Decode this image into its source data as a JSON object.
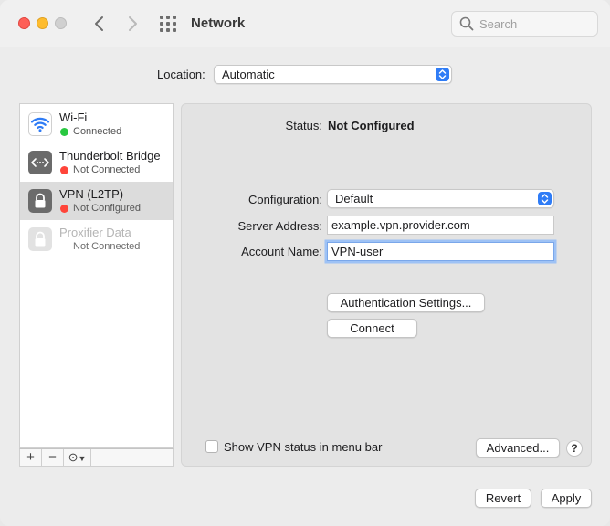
{
  "window": {
    "title": "Network"
  },
  "search": {
    "placeholder": "Search"
  },
  "location": {
    "label": "Location:",
    "value": "Automatic"
  },
  "services": [
    {
      "name": "Wi-Fi",
      "status": "Connected",
      "status_color": "#28c840",
      "icon": "wifi-icon"
    },
    {
      "name": "Thunderbolt Bridge",
      "status": "Not Connected",
      "status_color": "#ff453a",
      "icon": "thunderbolt-bridge-icon"
    },
    {
      "name": "VPN (L2TP)",
      "status": "Not Configured",
      "status_color": "#ff453a",
      "icon": "lock-icon",
      "selected": true
    },
    {
      "name": "Proxifier Data",
      "status": "Not Connected",
      "icon": "lock-icon",
      "disabled": true
    }
  ],
  "sidebar_controls": {
    "add": "+",
    "remove": "−",
    "action": "⊙"
  },
  "detail": {
    "status_label": "Status:",
    "status_value": "Not Configured",
    "configuration_label": "Configuration:",
    "configuration_value": "Default",
    "server_label": "Server Address:",
    "server_value": "example.vpn.provider.com",
    "account_label": "Account Name:",
    "account_value": "VPN-user",
    "auth_button": "Authentication Settings...",
    "connect_button": "Connect",
    "show_status_label": "Show VPN status in menu bar",
    "show_status_checked": false,
    "advanced_button": "Advanced...",
    "help_button": "?"
  },
  "footer": {
    "revert": "Revert",
    "apply": "Apply"
  }
}
